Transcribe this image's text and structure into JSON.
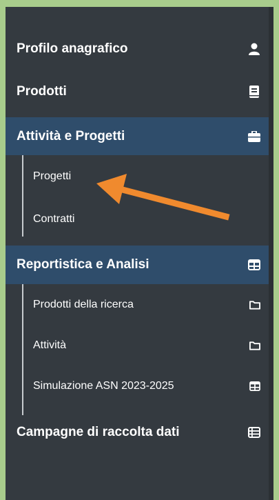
{
  "menu": {
    "profile": {
      "label": "Profilo anagrafico",
      "icon": "user-icon"
    },
    "products": {
      "label": "Prodotti",
      "icon": "book-icon"
    },
    "activities": {
      "label": "Attività e Progetti",
      "icon": "briefcase-icon",
      "active": true,
      "children": [
        {
          "label": "Progetti"
        },
        {
          "label": "Contratti"
        }
      ]
    },
    "reporting": {
      "label": "Reportistica e Analisi",
      "icon": "table-icon",
      "active": true,
      "children": [
        {
          "label": "Prodotti della ricerca",
          "icon": "folder-icon"
        },
        {
          "label": "Attività",
          "icon": "folder-icon"
        },
        {
          "label": "Simulazione ASN 2023-2025",
          "icon": "table-icon"
        }
      ]
    },
    "campaigns": {
      "label": "Campagne di raccolta dati",
      "icon": "list-table-icon"
    }
  },
  "colors": {
    "sidebar_bg": "#343a40",
    "active_bg": "#2f4d6b",
    "page_bg": "#a8cc8c",
    "arrow": "#f08a2e"
  }
}
